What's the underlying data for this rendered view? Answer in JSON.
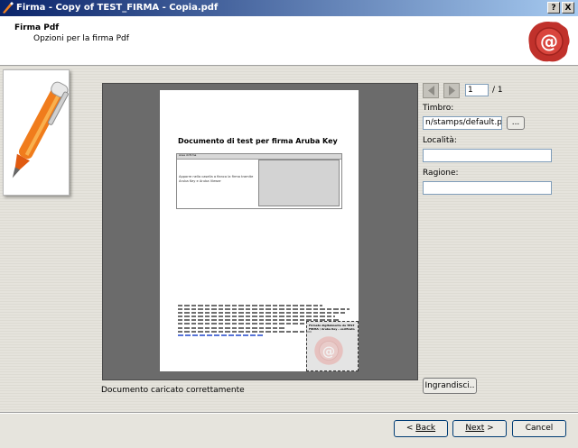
{
  "window": {
    "title": "Firma - Copy of TEST_FIRMA - Copia.pdf",
    "help_label": "?",
    "close_label": "X"
  },
  "header": {
    "title": "Firma Pdf",
    "subtitle": "Opzioni per la firma Pdf"
  },
  "preview": {
    "doc_title": "Documento di test per firma Aruba Key",
    "table_header": "Area di firma",
    "table_text": "Apporre nella casella a fianco la firma tramite Aruba Key e Aruba Viewer",
    "stamp_text": "Firmato digitalmente da TEST FIRMA / Aruba Key - verificato"
  },
  "nav": {
    "page_number": "1",
    "page_total": "/ 1"
  },
  "form": {
    "timbro_label": "Timbro:",
    "timbro_value": "n/stamps/default.png",
    "browse_label": "...",
    "localita_label": "Località:",
    "localita_value": "",
    "ragione_label": "Ragione:",
    "ragione_value": ""
  },
  "zoom_button": "Ingrandisci..",
  "status": "Documento caricato correttamente",
  "footer": {
    "back": "Back",
    "next": "Next",
    "cancel": "Cancel"
  },
  "colors": {
    "title_bar": "#0a246a",
    "preview_bg": "#6b6b6b",
    "seal_red": "#c0312b"
  }
}
